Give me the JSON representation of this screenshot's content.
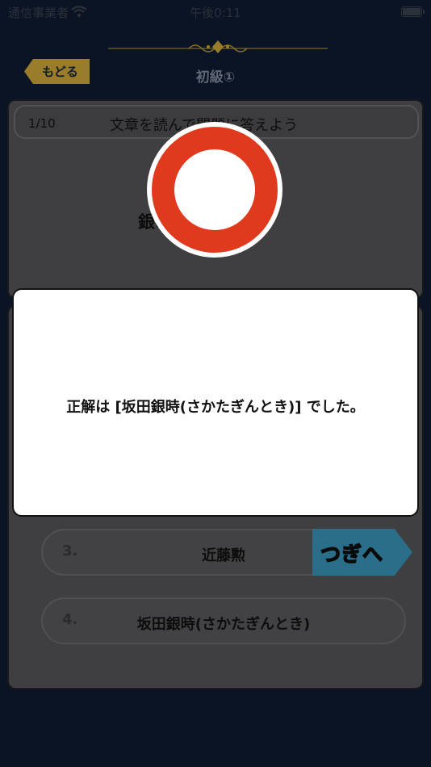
{
  "status_bar": {
    "carrier": "通信事業者",
    "time": "午後0:11"
  },
  "nav": {
    "back_label": "もどる",
    "title": "初級①"
  },
  "question": {
    "progress": "1/10",
    "instruction": "文章を読んで問題に答えよう",
    "text": "銀時の主人公は？"
  },
  "options": [
    {
      "number": "3.",
      "label": "近藤勲"
    },
    {
      "number": "4.",
      "label": "坂田銀時(さかたぎんとき)"
    }
  ],
  "result": {
    "message": "正解は [坂田銀時(さかたぎんとき)] でした。"
  },
  "next_label": "つぎへ",
  "colors": {
    "background": "#0b1424",
    "accent_gold": "#9a7d2a",
    "correct_red": "#e03a1e",
    "next_blue": "#2a6e8a"
  }
}
